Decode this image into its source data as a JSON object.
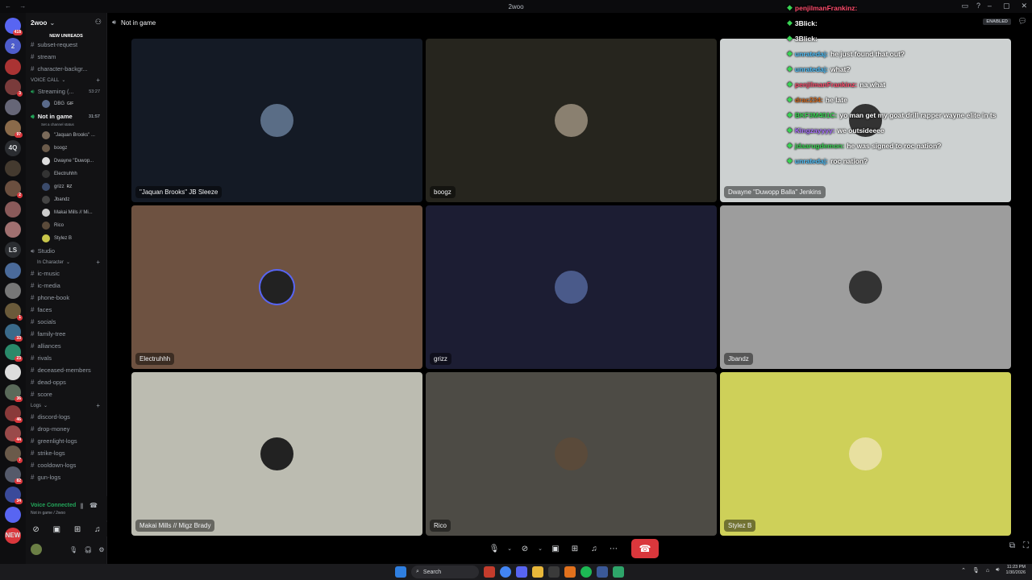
{
  "window": {
    "title": "2woo"
  },
  "server": {
    "name": "2woo",
    "new_unreads": "NEW UNREADS"
  },
  "rail": [
    {
      "label": "",
      "badge": "418",
      "color": "#5865f2"
    },
    {
      "label": "2",
      "badge": "",
      "color": "#4e5dcc"
    },
    {
      "label": "",
      "badge": "",
      "color": "#a33"
    },
    {
      "label": "",
      "badge": "3",
      "color": "#7a3b3b"
    },
    {
      "label": "",
      "badge": "",
      "color": "#667"
    },
    {
      "label": "",
      "badge": "97",
      "color": "#8a6a4a"
    },
    {
      "label": "4Q",
      "badge": "",
      "color": "#2b2d31"
    },
    {
      "label": "",
      "badge": "",
      "color": "#443a2f"
    },
    {
      "label": "",
      "badge": "2",
      "color": "#6b4f3f"
    },
    {
      "label": "",
      "badge": "",
      "color": "#8a5a5a"
    },
    {
      "label": "",
      "badge": "",
      "color": "#a07070"
    },
    {
      "label": "LS",
      "badge": "",
      "color": "#2b2d31"
    },
    {
      "label": "",
      "badge": "",
      "color": "#4a6a9a"
    },
    {
      "label": "",
      "badge": "",
      "color": "#777"
    },
    {
      "label": "",
      "badge": "1",
      "color": "#6a5a3a"
    },
    {
      "label": "",
      "badge": "33",
      "color": "#3a6a8a"
    },
    {
      "label": "",
      "badge": "23",
      "color": "#2a8a6a"
    },
    {
      "label": "",
      "badge": "",
      "color": "#ddd"
    },
    {
      "label": "",
      "badge": "36",
      "color": "#5a6a5a"
    },
    {
      "label": "",
      "badge": "46",
      "color": "#8a3a3a"
    },
    {
      "label": "",
      "badge": "44",
      "color": "#9a4a4a"
    },
    {
      "label": "",
      "badge": "7",
      "color": "#6a5a4a"
    },
    {
      "label": "",
      "badge": "82",
      "color": "#555a6a"
    },
    {
      "label": "",
      "badge": "34",
      "color": "#3a4a9a"
    },
    {
      "label": "",
      "badge": "",
      "color": "#5865f2"
    },
    {
      "label": "NEW",
      "badge": "",
      "color": "#da373c"
    }
  ],
  "channels_top": [
    {
      "name": "subset-request"
    },
    {
      "name": "stream"
    },
    {
      "name": "character-backgr..."
    }
  ],
  "voice_category": "VOICE CALL",
  "voice_channels": {
    "streaming": {
      "name": "Streaming (...",
      "time": "53:27",
      "users": [
        {
          "name": "DBG",
          "tag": "GIF"
        }
      ]
    },
    "current": {
      "name": "Not in game",
      "time": "31:57",
      "status": "Set a channel status",
      "users": [
        {
          "name": "\"Jaquan Brooks\" ...",
          "color": "#7a6a5a"
        },
        {
          "name": "boogz",
          "color": "#6a5a4a"
        },
        {
          "name": "Dwayne \"Duwop...",
          "color": "#ddd"
        },
        {
          "name": "Electruhhh",
          "color": "#333"
        },
        {
          "name": "grizz",
          "tag": "RZ",
          "color": "#3a4a6a"
        },
        {
          "name": "Jbandz",
          "color": "#444"
        },
        {
          "name": "Makai Mills // Mi...",
          "color": "#ccc"
        },
        {
          "name": "Rico",
          "color": "#5a4a3a"
        },
        {
          "name": "Stylez B",
          "color": "#c8c64a"
        }
      ]
    },
    "studio": {
      "name": "Studio"
    }
  },
  "ic_category": "In Character",
  "ic_channels": [
    {
      "name": "ic-music"
    },
    {
      "name": "ic-media"
    },
    {
      "name": "phone-book"
    },
    {
      "name": "faces"
    },
    {
      "name": "socials"
    },
    {
      "name": "family-tree"
    },
    {
      "name": "alliances"
    },
    {
      "name": "rivals"
    },
    {
      "name": "deceased-members"
    },
    {
      "name": "dead-opps"
    },
    {
      "name": "score"
    }
  ],
  "logs_category": "Logs",
  "logs_channels": [
    {
      "name": "discord-logs"
    },
    {
      "name": "drop-money"
    },
    {
      "name": "greenlight-logs"
    },
    {
      "name": "strike-logs"
    },
    {
      "name": "cooldown-logs"
    },
    {
      "name": "gun-logs"
    }
  ],
  "voice_status": {
    "connected": "Voice Connected",
    "where": "Not in game / 2woo"
  },
  "header": {
    "channel": "Not in game",
    "enabled": "ENABLED"
  },
  "tiles": [
    {
      "name": "\"Jaquan Brooks\" JB Sleeze",
      "bg": "#141a25",
      "av": "#5a6d86"
    },
    {
      "name": "boogz",
      "bg": "#26251e",
      "av": "#8a8070"
    },
    {
      "name": "Dwayne \"Duwopp Balla\" Jenkins",
      "bg": "#cdd1d1",
      "av": "#333"
    },
    {
      "name": "Electruhhh",
      "bg": "#6e5241",
      "av": "#222",
      "speaking": true
    },
    {
      "name": "grizz",
      "bg": "#1c1d33",
      "av": "#4a5a8a"
    },
    {
      "name": "Jbandz",
      "bg": "#9d9d9d",
      "av": "#333"
    },
    {
      "name": "Makai Mills // Migz Brady",
      "bg": "#bcbcb1",
      "av": "#222"
    },
    {
      "name": "Rico",
      "bg": "#4d4b45",
      "av": "#5a4a3a"
    },
    {
      "name": "Stylez B",
      "bg": "#ced059",
      "av": "#e8e0a0"
    }
  ],
  "chat": [
    {
      "user": "penjilmanFrankinz:",
      "msg": "",
      "color": "#ff4d6d"
    },
    {
      "user": "3Blick:",
      "msg": "",
      "color": "#ffffff"
    },
    {
      "user": "3Blick:",
      "msg": "",
      "color": "#ffffff"
    },
    {
      "user": "unratedaj:",
      "msg": "he just found that out?",
      "color": "#4fc3ff"
    },
    {
      "user": "unratedaj:",
      "msg": "what?",
      "color": "#4fc3ff"
    },
    {
      "user": "penjilmanFrankinz:",
      "msg": "na what",
      "color": "#ff4d6d"
    },
    {
      "user": "drac234:",
      "msg": "he late",
      "color": "#d2691e"
    },
    {
      "user": "BKF3M401C:",
      "msg": "yo man get my goat drill rapper wayne elite in ts",
      "color": "#39d353"
    },
    {
      "user": "Kingzayyyy:",
      "msg": "we outsideeee",
      "color": "#a970ff"
    },
    {
      "user": "jdaarugdemon:",
      "msg": "he was signed to roc nation?",
      "color": "#39d353"
    },
    {
      "user": "unratedaj:",
      "msg": "roc nation?",
      "color": "#4fc3ff"
    }
  ],
  "taskbar": {
    "search": "Search",
    "time": "11:23 PM",
    "date": "1/30/2026"
  }
}
